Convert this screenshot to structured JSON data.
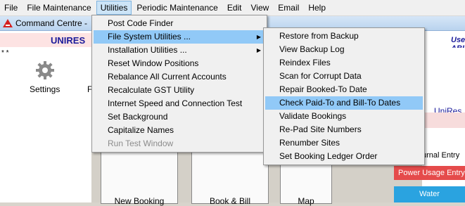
{
  "menubar": {
    "items": [
      {
        "label": "File"
      },
      {
        "label": "File Maintenance"
      },
      {
        "label": "Utilities"
      },
      {
        "label": "Periodic Maintenance"
      },
      {
        "label": "Edit"
      },
      {
        "label": "View"
      },
      {
        "label": "Email"
      },
      {
        "label": "Help"
      }
    ]
  },
  "window": {
    "title": "Command Centre -"
  },
  "header": {
    "org": "UNIRES",
    "user_label": "Use",
    "user_abbr": "ABI",
    "stars": "* *"
  },
  "toolbar": {
    "settings_label": "Settings",
    "partial_label": "F"
  },
  "right_panel": {
    "unires_link": "UniRes",
    "journal_label": "urnal Entry",
    "power_label": "Power Usage Entry",
    "water_label": "Water"
  },
  "tiles": [
    {
      "label": "New Booking"
    },
    {
      "label": "Book & Bill"
    },
    {
      "label": "Map"
    }
  ],
  "utilities_menu": [
    {
      "label": "Post Code Finder",
      "submenu": false,
      "disabled": false
    },
    {
      "label": "File System Utilities ...",
      "submenu": true,
      "disabled": false
    },
    {
      "label": "Installation Utilities ...",
      "submenu": true,
      "disabled": false
    },
    {
      "label": "Reset Window Positions",
      "submenu": false,
      "disabled": false
    },
    {
      "label": "Rebalance All Current Accounts",
      "submenu": false,
      "disabled": false
    },
    {
      "label": "Recalculate GST Utility",
      "submenu": false,
      "disabled": false
    },
    {
      "label": "Internet Speed and Connection Test",
      "submenu": false,
      "disabled": false
    },
    {
      "label": "Set Background",
      "submenu": false,
      "disabled": false
    },
    {
      "label": "Capitalize Names",
      "submenu": false,
      "disabled": false
    },
    {
      "label": "Run Test Window",
      "submenu": false,
      "disabled": true
    }
  ],
  "filesystem_menu": [
    {
      "label": "Restore from Backup"
    },
    {
      "label": "View Backup Log"
    },
    {
      "label": "Reindex Files"
    },
    {
      "label": "Scan for Corrupt Data"
    },
    {
      "label": "Repair Booked-To Date"
    },
    {
      "label": "Check Paid-To and Bill-To Dates"
    },
    {
      "label": "Validate Bookings"
    },
    {
      "label": "Re-Pad Site Numbers"
    },
    {
      "label": "Renumber Sites"
    },
    {
      "label": "Set Booking Ledger Order"
    }
  ],
  "colors": {
    "highlight": "#91c9f7",
    "power": "#e54b4b",
    "water": "#2aa3e0",
    "org_text": "#1a1a9a"
  }
}
